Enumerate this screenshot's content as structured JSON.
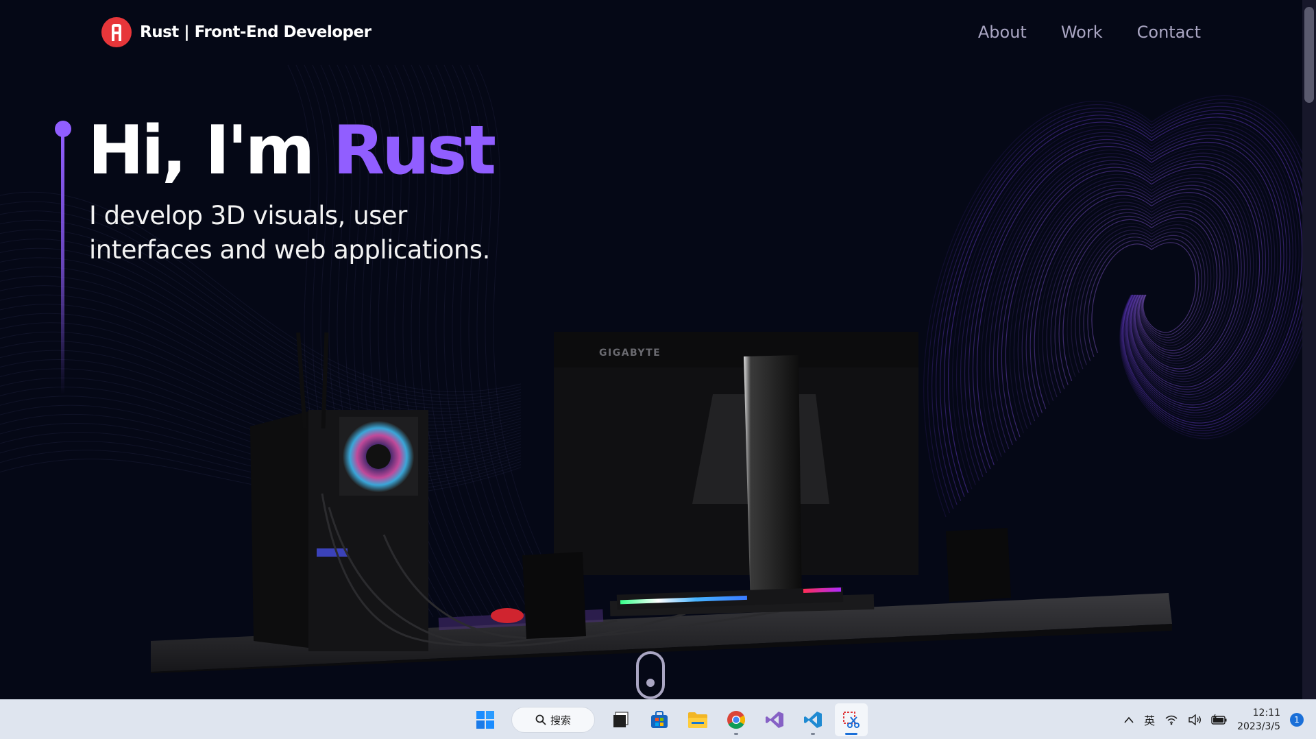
{
  "nav": {
    "brand": "Rust | Front-End Developer",
    "links": [
      "About",
      "Work",
      "Contact"
    ]
  },
  "hero": {
    "greeting": "Hi, I'm ",
    "name": "Rust",
    "subtitle_line1": "I develop 3D visuals, user",
    "subtitle_line2": "interfaces and web applications."
  },
  "scene": {
    "monitor_brand": "GIGABYTE"
  },
  "taskbar": {
    "search_label": "搜索",
    "input_method": "英",
    "time": "12:11",
    "date": "2023/3/5",
    "notification_count": "1",
    "apps": [
      "start-icon",
      "search",
      "task-view-icon",
      "store-icon",
      "file-explorer-icon",
      "chrome-icon",
      "visual-studio-icon",
      "vscode-icon",
      "snipping-tool-icon"
    ]
  },
  "colors": {
    "background": "#050816",
    "accent": "#915eff",
    "nav_text": "#aaa6c3",
    "logo": "#e7363a"
  }
}
